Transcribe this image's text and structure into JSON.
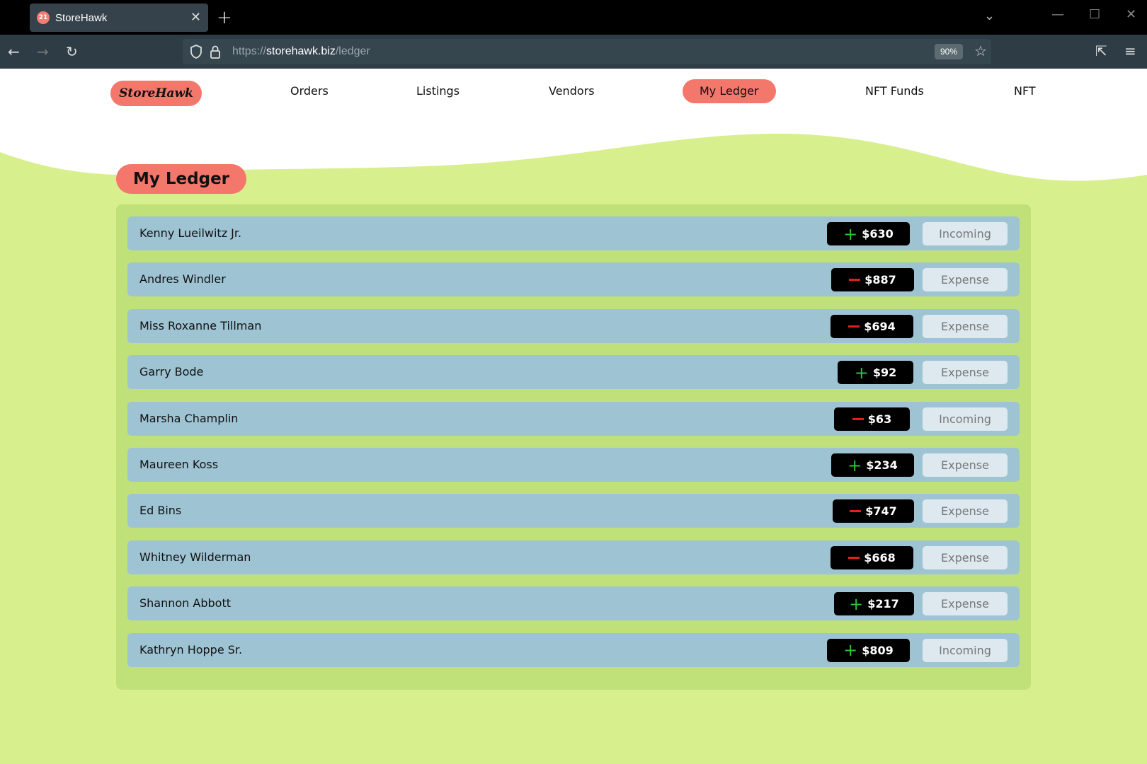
{
  "browser": {
    "tab_title": "StoreHawk",
    "url_prefix": "https://",
    "url_host": "storehawk.biz",
    "url_path": "/ledger",
    "zoom": "90%"
  },
  "site": {
    "logo": "StoreHawk",
    "nav": [
      "Orders",
      "Listings",
      "Vendors",
      "My Ledger",
      "NFT Funds",
      "NFT"
    ],
    "active_nav": "My Ledger"
  },
  "page_title": "My Ledger",
  "ledger": [
    {
      "name": "Kenny Lueilwitz Jr.",
      "sign": "+",
      "amount": "$630",
      "type": "Incoming"
    },
    {
      "name": "Andres Windler",
      "sign": "-",
      "amount": "$887",
      "type": "Expense"
    },
    {
      "name": "Miss Roxanne Tillman",
      "sign": "-",
      "amount": "$694",
      "type": "Expense"
    },
    {
      "name": "Garry Bode",
      "sign": "+",
      "amount": "$92",
      "type": "Expense"
    },
    {
      "name": "Marsha Champlin",
      "sign": "-",
      "amount": "$63",
      "type": "Incoming"
    },
    {
      "name": "Maureen Koss",
      "sign": "+",
      "amount": "$234",
      "type": "Expense"
    },
    {
      "name": "Ed Bins",
      "sign": "-",
      "amount": "$747",
      "type": "Expense"
    },
    {
      "name": "Whitney Wilderman",
      "sign": "-",
      "amount": "$668",
      "type": "Expense"
    },
    {
      "name": "Shannon Abbott",
      "sign": "+",
      "amount": "$217",
      "type": "Expense"
    },
    {
      "name": "Kathryn Hoppe Sr.",
      "sign": "+",
      "amount": "$809",
      "type": "Incoming"
    }
  ],
  "colors": {
    "accent": "#f4776b",
    "background": "#d8ef8d",
    "panel": "#c0e07a",
    "row": "#9ec3d3",
    "plus": "#2fbf3a",
    "minus": "#e0201a"
  }
}
